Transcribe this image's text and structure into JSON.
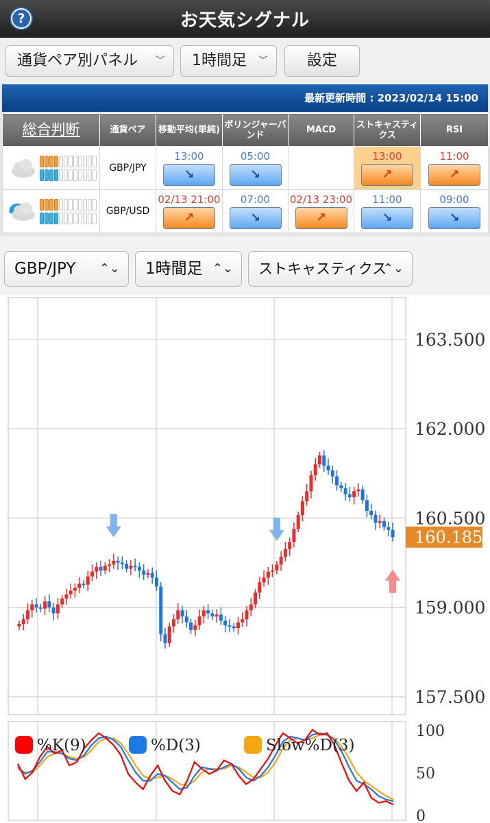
{
  "header": {
    "title": "お天気シグナル",
    "help_icon": "?"
  },
  "toolbar": {
    "panel_select": "通貨ペア別パネル",
    "timeframe_select": "1時間足",
    "settings_label": "設定"
  },
  "panel": {
    "updated": "最新更新時間 : 2023/02/14 15:00",
    "columns": [
      "総合判断",
      "通貨ペア",
      "移動平均(単純)",
      "ボリンジャーバンド",
      "MACD",
      "ストキャスティクス",
      "RSI"
    ],
    "rows": [
      {
        "weather": "cloud-icon",
        "pair": "GBP/JPY",
        "strength_top": {
          "orange": 4,
          "total": 12
        },
        "strength_bottom": {
          "blue": 4,
          "total": 12
        },
        "signals": [
          {
            "time": "13:00",
            "dir": "down",
            "color": "blue",
            "symbol": "↘"
          },
          {
            "time": "05:00",
            "dir": "down",
            "color": "blue",
            "symbol": "↘"
          },
          {
            "time": "",
            "dir": "none",
            "color": "",
            "symbol": ""
          },
          {
            "time": "13:00",
            "dir": "up",
            "color": "red",
            "symbol": "↗",
            "highlight": true
          },
          {
            "time": "11:00",
            "dir": "up",
            "color": "red",
            "symbol": "↗"
          }
        ]
      },
      {
        "weather": "sun-cloud-icon",
        "pair": "GBP/USD",
        "strength_top": {
          "orange": 4,
          "total": 12
        },
        "strength_bottom": {
          "blue": 4,
          "total": 12
        },
        "signals": [
          {
            "time": "02/13 21:00",
            "dir": "up",
            "color": "red",
            "symbol": "↗"
          },
          {
            "time": "07:00",
            "dir": "down",
            "color": "blue",
            "symbol": "↘"
          },
          {
            "time": "02/13 23:00",
            "dir": "up",
            "color": "red",
            "symbol": "↗"
          },
          {
            "time": "11:00",
            "dir": "down",
            "color": "blue",
            "symbol": "↘"
          },
          {
            "time": "09:00",
            "dir": "down",
            "color": "blue",
            "symbol": "↘"
          }
        ]
      }
    ]
  },
  "chart_controls": {
    "pair": "GBP/JPY",
    "timeframe": "1時間足",
    "indicator": "ストキャスティクス"
  },
  "chart_data": [
    {
      "type": "candlestick",
      "ylim": [
        157.2,
        164.2
      ],
      "ticks": [
        "163.500",
        "162.000",
        "160.500",
        "159.000",
        "157.500"
      ],
      "tick_values": [
        163.5,
        162.0,
        160.5,
        159.0,
        157.5
      ],
      "current_price": "160.185",
      "current_value": 160.185,
      "close": [
        158.72,
        158.8,
        158.95,
        159.05,
        159.0,
        158.98,
        159.1,
        159.0,
        158.9,
        159.05,
        159.15,
        159.22,
        159.28,
        159.33,
        159.4,
        159.38,
        159.52,
        159.6,
        159.68,
        159.62,
        159.7,
        159.72,
        159.78,
        159.75,
        159.73,
        159.65,
        159.7,
        159.68,
        159.62,
        159.55,
        159.58,
        159.5,
        159.35,
        158.55,
        158.4,
        158.68,
        158.8,
        158.95,
        158.85,
        158.75,
        158.62,
        158.7,
        158.85,
        158.95,
        158.9,
        158.85,
        158.88,
        158.78,
        158.7,
        158.68,
        158.65,
        158.75,
        158.8,
        158.95,
        159.05,
        159.25,
        159.42,
        159.5,
        159.6,
        159.62,
        159.72,
        159.85,
        159.98,
        160.1,
        160.32,
        160.55,
        160.78,
        160.95,
        161.22,
        161.4,
        161.55,
        161.38,
        161.3,
        161.2,
        161.05,
        161.0,
        160.9,
        160.85,
        160.95,
        160.98,
        160.8,
        160.62,
        160.55,
        160.42,
        160.45,
        160.35,
        160.3,
        160.18
      ],
      "signal_markers": [
        {
          "type": "sell",
          "index": 22,
          "label": "down-arrow"
        },
        {
          "type": "sell",
          "index": 60,
          "label": "down-arrow"
        },
        {
          "type": "buy",
          "index": 87,
          "label": "up-arrow"
        }
      ]
    },
    {
      "type": "line",
      "title": "stochastics",
      "ylim": [
        0,
        100
      ],
      "ticks": [
        "100",
        "50",
        "0"
      ],
      "tick_values": [
        100,
        50,
        0
      ],
      "series": [
        {
          "name": "%K(9)",
          "color": "#ff0000",
          "values": [
            60,
            42,
            50,
            68,
            80,
            72,
            76,
            58,
            62,
            78,
            88,
            96,
            90,
            82,
            70,
            48,
            38,
            30,
            46,
            58,
            40,
            28,
            24,
            40,
            62,
            54,
            48,
            52,
            64,
            60,
            46,
            36,
            42,
            54,
            66,
            82,
            96,
            90,
            84,
            88,
            100,
            94,
            96,
            82,
            60,
            40,
            28,
            38,
            20,
            14,
            16,
            12
          ]
        },
        {
          "name": "%D(3)",
          "color": "#1e78e6",
          "values": [
            56,
            48,
            52,
            62,
            74,
            74,
            72,
            66,
            64,
            70,
            82,
            90,
            92,
            88,
            80,
            64,
            50,
            40,
            40,
            48,
            46,
            38,
            30,
            32,
            46,
            56,
            54,
            52,
            56,
            60,
            54,
            44,
            40,
            46,
            56,
            70,
            86,
            92,
            90,
            88,
            94,
            96,
            94,
            88,
            74,
            56,
            40,
            36,
            30,
            22,
            18,
            16
          ]
        },
        {
          "name": "Slow%D(3)",
          "color": "#f5a614",
          "values": [
            54,
            50,
            50,
            58,
            68,
            72,
            72,
            68,
            66,
            68,
            76,
            86,
            90,
            90,
            84,
            72,
            58,
            46,
            42,
            44,
            46,
            42,
            36,
            34,
            40,
            50,
            54,
            54,
            54,
            58,
            56,
            50,
            44,
            44,
            50,
            62,
            78,
            88,
            90,
            88,
            90,
            94,
            94,
            90,
            80,
            66,
            50,
            40,
            34,
            28,
            22,
            18
          ]
        }
      ]
    }
  ]
}
